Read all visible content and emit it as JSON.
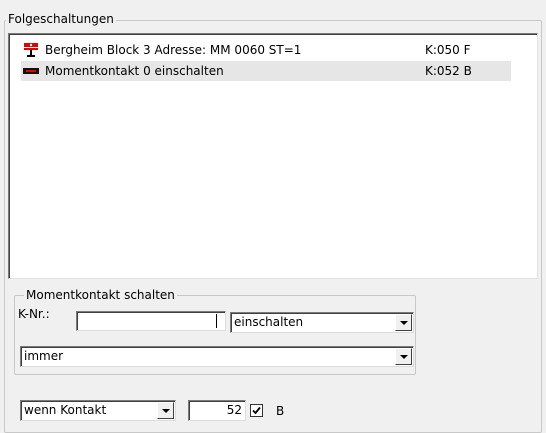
{
  "folgeschaltungen": {
    "title": "Folgeschaltungen",
    "items": [
      {
        "icon": "signal-icon",
        "description": "Bergheim Block 3 Adresse: MM 0060 ST=1",
        "knr": "K:050 F",
        "selected": false
      },
      {
        "icon": "momentkontakt-icon",
        "description": "Momentkontakt 0 einschalten",
        "knr": "K:052 B",
        "selected": true
      }
    ]
  },
  "momentkontakt": {
    "title": "Momentkontakt schalten",
    "knr_label": "K-Nr.:",
    "knr_value": "",
    "action": "einschalten",
    "condition": "immer"
  },
  "bottom": {
    "condition_type": "wenn Kontakt",
    "contact_number": "52",
    "checkbox_checked": true,
    "checkbox_label": "B"
  },
  "colors": {
    "signal_red": "#e00000",
    "window_bg": "#f0f0f0",
    "selection_bg": "#e6e6e6"
  }
}
